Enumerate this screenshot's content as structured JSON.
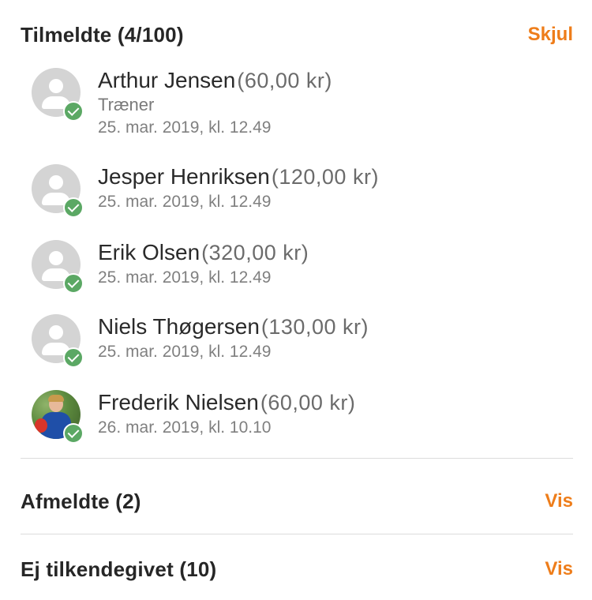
{
  "signed_up": {
    "title": "Tilmeldte",
    "count": "(4/100)",
    "toggle": "Skjul",
    "members": [
      {
        "name": "Arthur Jensen",
        "amount": "(60,00 kr)",
        "role": "Træner",
        "date": "25. mar. 2019, kl. 12.49",
        "avatar": "placeholder"
      },
      {
        "name": "Jesper Henriksen",
        "amount": "(120,00 kr)",
        "date": "25. mar. 2019, kl. 12.49",
        "avatar": "placeholder"
      },
      {
        "name": "Erik Olsen",
        "amount": "(320,00 kr)",
        "date": "25. mar. 2019, kl. 12.49",
        "avatar": "placeholder"
      },
      {
        "name": "Niels Thøgersen",
        "amount": "(130,00 kr)",
        "date": "25. mar. 2019, kl. 12.49",
        "avatar": "placeholder"
      },
      {
        "name": "Frederik Nielsen",
        "amount": "(60,00 kr)",
        "date": "26. mar. 2019, kl. 10.10",
        "avatar": "photo"
      }
    ]
  },
  "declined": {
    "title": "Afmeldte",
    "count": "(2)",
    "toggle": "Vis"
  },
  "no_reply": {
    "title": "Ej tilkendegivet",
    "count": "(10)",
    "toggle": "Vis"
  },
  "colors": {
    "accent": "#ee7d1a",
    "check": "#5ba864"
  },
  "icons": {
    "status": "check-circle-icon",
    "avatar": "user-placeholder-icon"
  }
}
